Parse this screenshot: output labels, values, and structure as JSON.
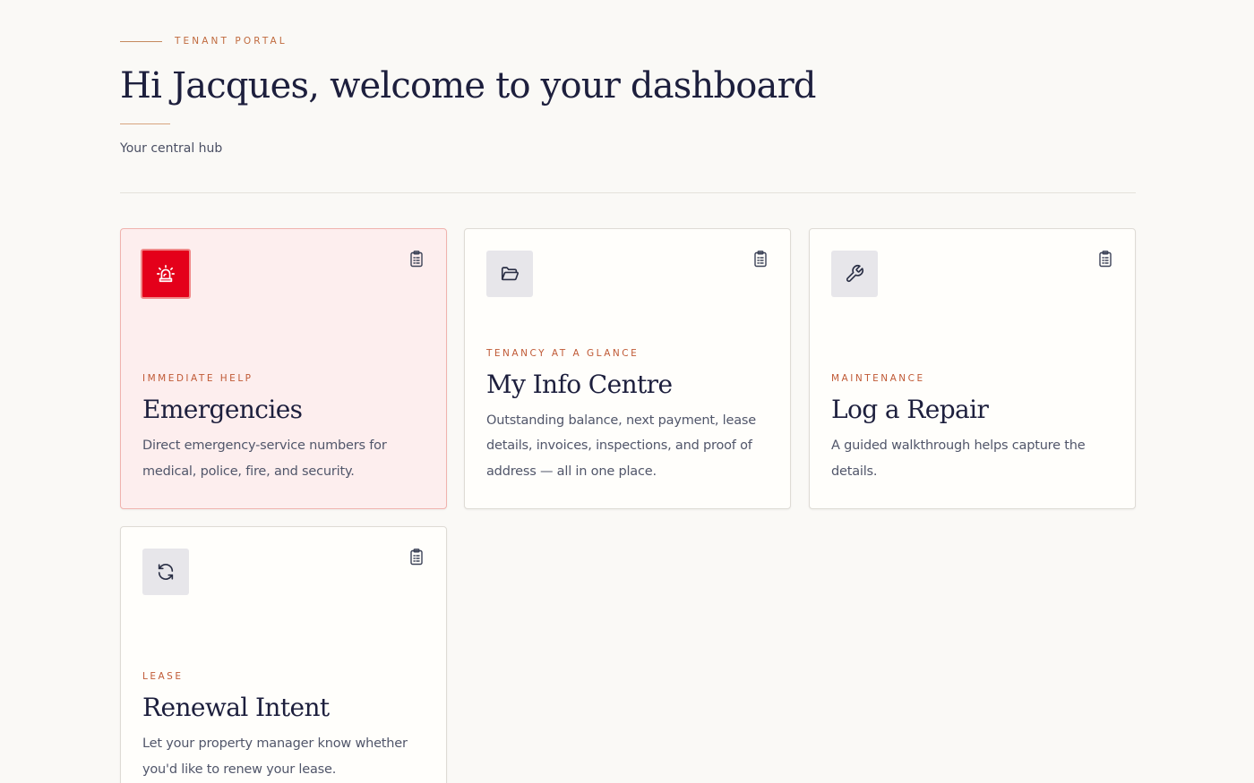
{
  "header": {
    "eyebrow": "TENANT PORTAL",
    "title": "Hi Jacques, welcome to your dashboard",
    "subtitle": "Your central hub"
  },
  "colors": {
    "accent": "#c06a3e",
    "emergency": "#e4001a",
    "emergency_card_bg": "#fdeeee"
  },
  "cards": [
    {
      "icon": "siren-icon",
      "kicker": "IMMEDIATE HELP",
      "title": "Emergencies",
      "description": "Direct emergency-service numbers for medical, police, fire, and security.",
      "corner_icon": "clipboard-icon"
    },
    {
      "icon": "folder-open-icon",
      "kicker": "TENANCY AT A GLANCE",
      "title": "My Info Centre",
      "description": "Outstanding balance, next payment, lease details, invoices, inspections, and proof of address — all in one place.",
      "corner_icon": "clipboard-icon"
    },
    {
      "icon": "wrench-icon",
      "kicker": "MAINTENANCE",
      "title": "Log a Repair",
      "description": "A guided walkthrough helps capture the details.",
      "corner_icon": "clipboard-icon"
    },
    {
      "icon": "refresh-icon",
      "kicker": "LEASE",
      "title": "Renewal Intent",
      "description": "Let your property manager know whether you'd like to renew your lease.",
      "corner_icon": "clipboard-icon"
    }
  ]
}
